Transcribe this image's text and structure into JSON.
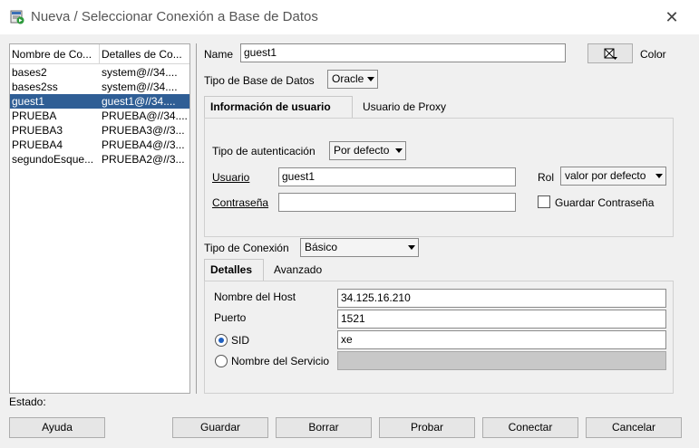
{
  "window": {
    "title": "Nueva / Seleccionar Conexión a Base de Datos"
  },
  "list": {
    "headers": [
      "Nombre de Co...",
      "Detalles de Co..."
    ],
    "rows": [
      {
        "name": "bases2",
        "details": "system@//34...."
      },
      {
        "name": "bases2ss",
        "details": "system@//34...."
      },
      {
        "name": "guest1",
        "details": "guest1@//34....",
        "selected": true
      },
      {
        "name": "PRUEBA",
        "details": "PRUEBA@//34...."
      },
      {
        "name": "PRUEBA3",
        "details": "PRUEBA3@//3..."
      },
      {
        "name": "PRUEBA4",
        "details": "PRUEBA4@//3..."
      },
      {
        "name": "segundoEsque...",
        "details": "PRUEBA2@//3..."
      }
    ]
  },
  "form": {
    "name_label": "Name",
    "name_value": "guest1",
    "color_label": "Color",
    "db_type_label": "Tipo de Base de Datos",
    "db_type_value": "Oracle",
    "tabs_user": [
      "Información de usuario",
      "Usuario de Proxy"
    ],
    "auth_type_label": "Tipo de autenticación",
    "auth_type_value": "Por defecto",
    "user_label": "Usuario",
    "user_value": "guest1",
    "role_label": "Rol",
    "role_value": "valor por defecto",
    "password_label": "Contraseña",
    "password_value": "",
    "save_password_label": "Guardar Contraseña",
    "conn_type_label": "Tipo de Conexión",
    "conn_type_value": "Básico",
    "tabs_conn": [
      "Detalles",
      "Avanzado"
    ],
    "host_label": "Nombre del Host",
    "host_value": "34.125.16.210",
    "port_label": "Puerto",
    "port_value": "1521",
    "sid_label": "SID",
    "sid_value": "xe",
    "service_label": "Nombre del Servicio",
    "service_value": ""
  },
  "status": {
    "label": "Estado:"
  },
  "buttons": {
    "help": "Ayuda",
    "save": "Guardar",
    "delete": "Borrar",
    "test": "Probar",
    "connect": "Conectar",
    "cancel": "Cancelar"
  }
}
